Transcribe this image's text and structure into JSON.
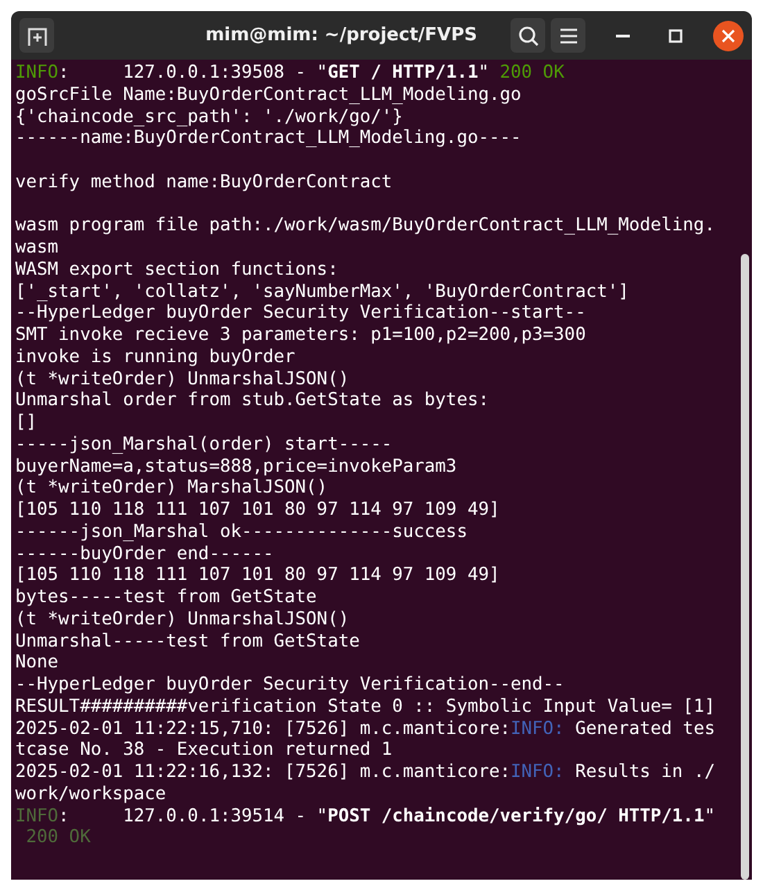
{
  "window": {
    "title": "mim@mim: ~/project/FVPS"
  },
  "lines": [
    {
      "kind": "text",
      "segments": [
        {
          "kind": "green",
          "text": "INFO"
        },
        {
          "kind": "plain",
          "text": ":     127.0.0.1:39508 - \""
        },
        {
          "kind": "bold",
          "text": "GET / HTTP/1.1"
        },
        {
          "kind": "plain",
          "text": "\" "
        },
        {
          "kind": "green",
          "text": "200 OK"
        }
      ]
    },
    {
      "kind": "text",
      "segments": [
        {
          "kind": "plain",
          "text": "goSrcFile Name:BuyOrderContract_LLM_Modeling.go"
        }
      ]
    },
    {
      "kind": "text",
      "segments": [
        {
          "kind": "plain",
          "text": "{'chaincode_src_path': './work/go/'}"
        }
      ]
    },
    {
      "kind": "text",
      "segments": [
        {
          "kind": "plain",
          "text": "------name:BuyOrderContract_LLM_Modeling.go----"
        }
      ]
    },
    {
      "kind": "blank"
    },
    {
      "kind": "text",
      "segments": [
        {
          "kind": "plain",
          "text": "verify method name:BuyOrderContract"
        }
      ]
    },
    {
      "kind": "blank"
    },
    {
      "kind": "text",
      "segments": [
        {
          "kind": "plain",
          "text": "wasm program file path:./work/wasm/BuyOrderContract_LLM_Modeling."
        }
      ]
    },
    {
      "kind": "text",
      "segments": [
        {
          "kind": "plain",
          "text": "wasm"
        }
      ]
    },
    {
      "kind": "text",
      "segments": [
        {
          "kind": "plain",
          "text": "WASM export section functions:"
        }
      ]
    },
    {
      "kind": "text",
      "segments": [
        {
          "kind": "plain",
          "text": "['_start', 'collatz', 'sayNumberMax', 'BuyOrderContract']"
        }
      ]
    },
    {
      "kind": "text",
      "segments": [
        {
          "kind": "plain",
          "text": "--HyperLedger buyOrder Security Verification--start--"
        }
      ]
    },
    {
      "kind": "text",
      "segments": [
        {
          "kind": "plain",
          "text": "SMT invoke recieve 3 parameters: p1=100,p2=200,p3=300"
        }
      ]
    },
    {
      "kind": "text",
      "segments": [
        {
          "kind": "plain",
          "text": "invoke is running buyOrder"
        }
      ]
    },
    {
      "kind": "text",
      "segments": [
        {
          "kind": "plain",
          "text": "(t *writeOrder) UnmarshalJSON()"
        }
      ]
    },
    {
      "kind": "text",
      "segments": [
        {
          "kind": "plain",
          "text": "Unmarshal order from stub.GetState as bytes:"
        }
      ]
    },
    {
      "kind": "text",
      "segments": [
        {
          "kind": "plain",
          "text": "[]"
        }
      ]
    },
    {
      "kind": "text",
      "segments": [
        {
          "kind": "plain",
          "text": "-----json_Marshal(order) start-----"
        }
      ]
    },
    {
      "kind": "text",
      "segments": [
        {
          "kind": "plain",
          "text": "buyerName=a,status=888,price=invokeParam3"
        }
      ]
    },
    {
      "kind": "text",
      "segments": [
        {
          "kind": "plain",
          "text": "(t *writeOrder) MarshalJSON()"
        }
      ]
    },
    {
      "kind": "text",
      "segments": [
        {
          "kind": "plain",
          "text": "[105 110 118 111 107 101 80 97 114 97 109 49]"
        }
      ]
    },
    {
      "kind": "text",
      "segments": [
        {
          "kind": "plain",
          "text": "------json_Marshal ok--------------success"
        }
      ]
    },
    {
      "kind": "text",
      "segments": [
        {
          "kind": "plain",
          "text": "------buyOrder end------"
        }
      ]
    },
    {
      "kind": "text",
      "segments": [
        {
          "kind": "plain",
          "text": "[105 110 118 111 107 101 80 97 114 97 109 49]"
        }
      ]
    },
    {
      "kind": "text",
      "segments": [
        {
          "kind": "plain",
          "text": "bytes-----test from GetState"
        }
      ]
    },
    {
      "kind": "text",
      "segments": [
        {
          "kind": "plain",
          "text": "(t *writeOrder) UnmarshalJSON()"
        }
      ]
    },
    {
      "kind": "text",
      "segments": [
        {
          "kind": "plain",
          "text": "Unmarshal-----test from GetState"
        }
      ]
    },
    {
      "kind": "text",
      "segments": [
        {
          "kind": "plain",
          "text": "None"
        }
      ]
    },
    {
      "kind": "text",
      "segments": [
        {
          "kind": "plain",
          "text": "--HyperLedger buyOrder Security Verification--end--"
        }
      ]
    },
    {
      "kind": "text",
      "segments": [
        {
          "kind": "plain",
          "text": "RESULT##########verification State 0 :: Symbolic Input Value= [1]"
        }
      ]
    },
    {
      "kind": "text",
      "segments": [
        {
          "kind": "plain",
          "text": "2025-02-01 11:22:15,710: [7526] m.c.manticore:"
        },
        {
          "kind": "blue",
          "text": "INFO:"
        },
        {
          "kind": "plain",
          "text": " Generated tes"
        }
      ]
    },
    {
      "kind": "text",
      "segments": [
        {
          "kind": "plain",
          "text": "tcase No. 38 - Execution returned 1"
        }
      ]
    },
    {
      "kind": "text",
      "segments": [
        {
          "kind": "plain",
          "text": "2025-02-01 11:22:16,132: [7526] m.c.manticore:"
        },
        {
          "kind": "blue",
          "text": "INFO:"
        },
        {
          "kind": "plain",
          "text": " Results in ./"
        }
      ]
    },
    {
      "kind": "text",
      "segments": [
        {
          "kind": "plain",
          "text": "work/workspace"
        }
      ]
    },
    {
      "kind": "text",
      "segments": [
        {
          "kind": "dim",
          "text": "INFO"
        },
        {
          "kind": "plain",
          "text": ":     127.0.0.1:39514 - \""
        },
        {
          "kind": "bold",
          "text": "POST /chaincode/verify/go/ HTTP/1.1"
        },
        {
          "kind": "plain",
          "text": "\""
        }
      ]
    },
    {
      "kind": "text",
      "segments": [
        {
          "kind": "dim",
          "text": " 200 OK"
        }
      ]
    }
  ]
}
